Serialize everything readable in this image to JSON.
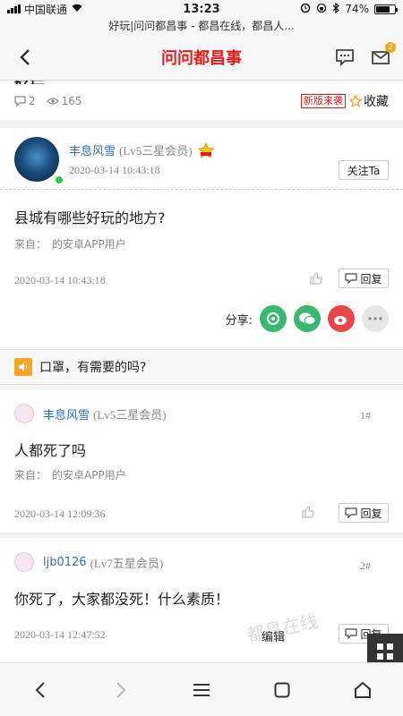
{
  "status": {
    "carrier": "中国联通",
    "time": "13:23",
    "battery": "74%",
    "battery_level": 0.74
  },
  "url_title": "好玩|问问都昌事 - 都昌在线，都昌人...",
  "header": {
    "title": "问问都昌事",
    "mail_badge": "2"
  },
  "post": {
    "title_fragment": "好玩",
    "comments": "2",
    "views": "165",
    "new_tag": "新版来袭",
    "favorite": "收藏"
  },
  "op": {
    "user": "丰息风雪",
    "level": "(Lv5三星会员)",
    "time": "2020-03-14 10:43:18",
    "follow": "关注Ta",
    "text": "县城有哪些好玩的地方?",
    "from": "来自：　的安卓APP用户",
    "post_time": "2020-03-14 10:43:18",
    "reply": "回复",
    "share_label": "分享:"
  },
  "notice": {
    "text": "口罩，有需要的吗?"
  },
  "replies": [
    {
      "user": "丰息风雪",
      "level": "(Lv5三星会员)",
      "floor": "1#",
      "text": "人都死了吗",
      "from": "来自：　的安卓APP用户",
      "time": "2020-03-14 12:09:36",
      "reply": "回复"
    },
    {
      "user": "ljb0126",
      "level": "(Lv7五星会员)",
      "floor": "2#",
      "text": "你死了，大家都没死！什么素质！",
      "time": "2020-03-14 12:47:52",
      "edit": "编辑",
      "reply": "回复"
    }
  ],
  "watermark": "都昌在线",
  "colors": {
    "accent": "#e21b1b",
    "link": "#2f6fbf"
  }
}
